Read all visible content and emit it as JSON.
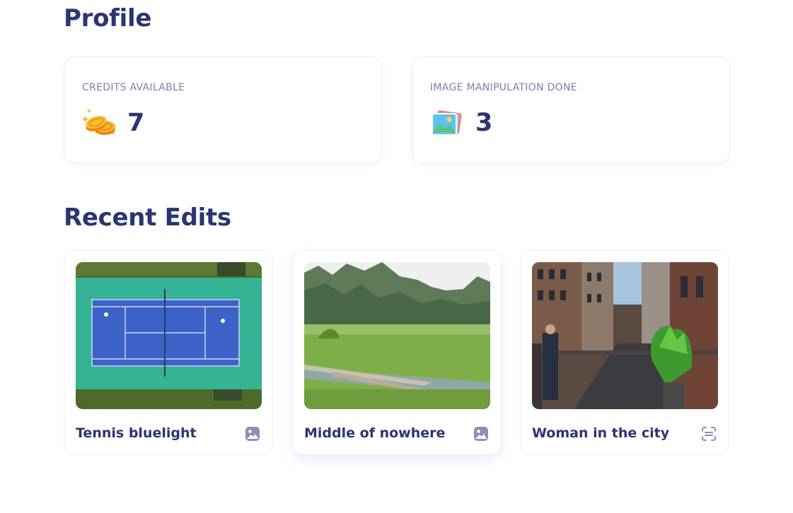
{
  "page": {
    "title": "Profile"
  },
  "stats": [
    {
      "label": "CREDITS AVAILABLE",
      "value": "7",
      "icon": "coins-icon"
    },
    {
      "label": "IMAGE MANIPULATION DONE",
      "value": "3",
      "icon": "images-icon"
    }
  ],
  "recent": {
    "title": "Recent Edits",
    "items": [
      {
        "caption": "Tennis bluelight",
        "thumb": "tennis-court-photo",
        "type_icon": "image-icon"
      },
      {
        "caption": "Middle of nowhere",
        "thumb": "karst-field-photo",
        "type_icon": "image-icon"
      },
      {
        "caption": "Woman in the city",
        "thumb": "city-street-photo",
        "type_icon": "scan-icon"
      }
    ]
  },
  "colors": {
    "heading": "#2a3572",
    "muted": "#7a80a8",
    "icon": "#8a8fb4",
    "card_border": "#ebe9fb"
  }
}
